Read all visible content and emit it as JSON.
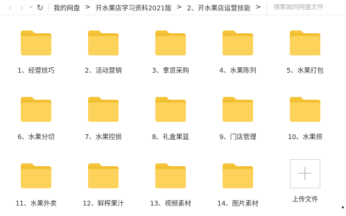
{
  "toolbar": {
    "back_icon": "chevron-left-icon",
    "forward_icon": "chevron-right-icon",
    "dropdown_icon": "chevron-down-icon",
    "refresh_icon": "refresh-icon"
  },
  "breadcrumb": {
    "items": [
      "我的网盘",
      "开水果店学习资料2021版",
      "2、开水果店运营技能"
    ],
    "separator": ">"
  },
  "search": {
    "placeholder": "搜索我的网盘文件"
  },
  "folders": [
    {
      "label": "1、经营技巧"
    },
    {
      "label": "2、活动营销"
    },
    {
      "label": "3、拿货采购"
    },
    {
      "label": "4、水果陈列"
    },
    {
      "label": "5、水果打包"
    },
    {
      "label": "6、水果分切"
    },
    {
      "label": "7、水果控损"
    },
    {
      "label": "8、礼盒果篮"
    },
    {
      "label": "9、门店管理"
    },
    {
      "label": "10、水果捞"
    },
    {
      "label": "11、水果外卖"
    },
    {
      "label": "12、鲜榨果汁"
    },
    {
      "label": "13、视频素材"
    },
    {
      "label": "14、图片素材"
    }
  ],
  "upload": {
    "icon": "plus-icon",
    "glyph": "+",
    "label": "上传文件"
  },
  "colors": {
    "folder_front": "#fdd25a",
    "folder_back": "#f3bf32",
    "text": "#333333"
  }
}
